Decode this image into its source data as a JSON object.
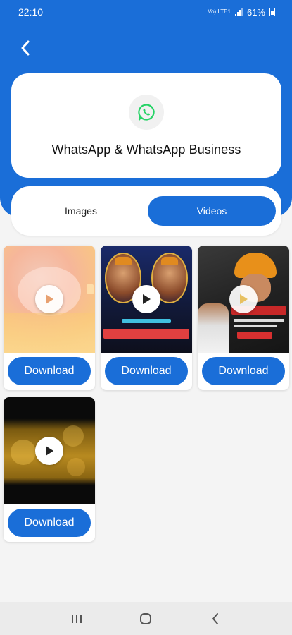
{
  "status_bar": {
    "time": "22:10",
    "network_label": "Vo) LTE1",
    "battery_text": "61%"
  },
  "header": {
    "back_icon": "chevron-left-icon",
    "app_icon": "whatsapp-icon",
    "title": "WhatsApp & WhatsApp Business"
  },
  "tabs": [
    {
      "label": "Images",
      "selected": false
    },
    {
      "label": "Videos",
      "selected": true
    }
  ],
  "videos": [
    {
      "download_label": "Download",
      "play_icon": "play-icon"
    },
    {
      "download_label": "Download",
      "play_icon": "play-icon"
    },
    {
      "download_label": "Download",
      "play_icon": "play-icon"
    },
    {
      "download_label": "Download",
      "play_icon": "play-icon"
    }
  ],
  "nav_bar": {
    "recents_icon": "recent-apps-icon",
    "home_icon": "home-icon",
    "back_icon": "back-icon"
  },
  "colors": {
    "primary": "#1a6ed8",
    "whatsapp_green": "#25d366",
    "background": "#f4f4f4"
  }
}
